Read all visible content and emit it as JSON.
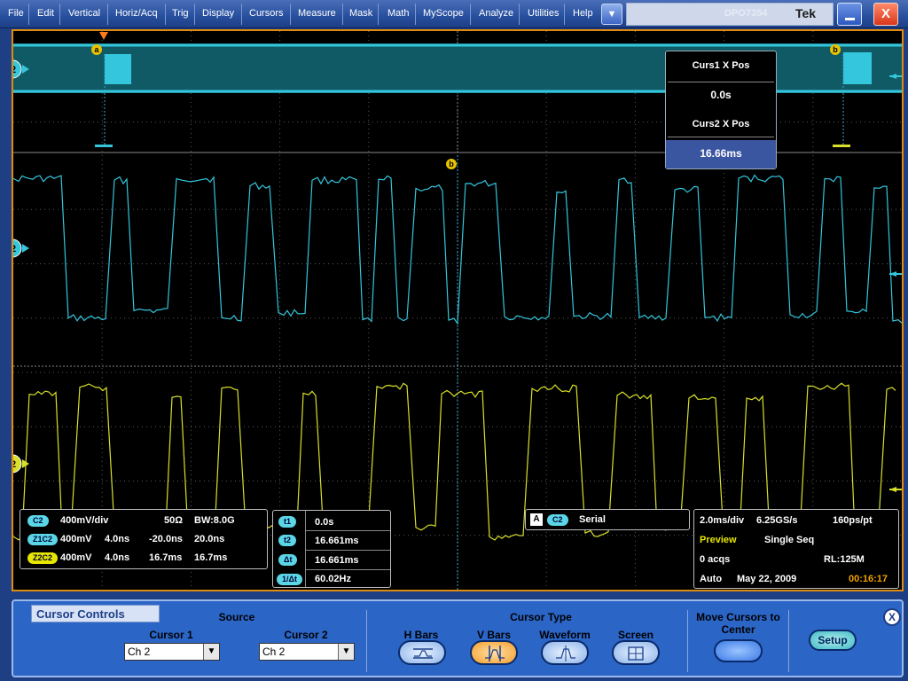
{
  "menubar": {
    "items": [
      "File",
      "Edit",
      "Vertical",
      "Horiz/Acq",
      "Trig",
      "Display",
      "Cursors",
      "Measure",
      "Mask",
      "Math",
      "MyScope",
      "Analyze",
      "Utilities",
      "Help"
    ],
    "dropdown_label": "▼",
    "logo_text": "DPO7354",
    "brand": "Tek",
    "close_label": "X"
  },
  "scope": {
    "channel_marker": "2",
    "cursor_a_label": "a",
    "cursor_b_label": "b",
    "colors": {
      "ch2": "#34c6dc",
      "zoom2": "#d8e02a",
      "trigger": "#ff7a1a",
      "grid": "#5a5a5a",
      "cursor": "#3aa8d6"
    }
  },
  "cursor_readout": {
    "c1_label": "Curs1 X Pos",
    "c1_value": "0.0s",
    "c2_label": "Curs2 X Pos",
    "c2_value": "16.66ms"
  },
  "channel_readout": {
    "rows": [
      {
        "badge": "C2",
        "a": "400mV/div",
        "b": "50Ω",
        "c": "BW:8.0G",
        "d": ""
      },
      {
        "badge": "Z1C2",
        "a": "400mV",
        "b": "4.0ns",
        "c": "-20.0ns",
        "d": "20.0ns"
      },
      {
        "badge": "Z2C2",
        "a": "400mV",
        "b": "4.0ns",
        "c": "16.7ms",
        "d": "16.7ms"
      }
    ]
  },
  "delta_readout": {
    "rows": [
      {
        "badge": "t1",
        "value": "0.0s"
      },
      {
        "badge": "t2",
        "value": "16.661ms"
      },
      {
        "badge": "Δt",
        "value": "16.661ms"
      },
      {
        "badge": "1/Δt",
        "value": "60.02Hz"
      }
    ]
  },
  "trigger_readout": {
    "badge_a": "A",
    "badge_c": "C2",
    "type": "Serial"
  },
  "acq_readout": {
    "hscale": "2.0ms/div",
    "rate": "6.25GS/s",
    "resolution": "160ps/pt",
    "mode": "Preview",
    "run": "Single Seq",
    "acqs": "0 acqs",
    "record": "RL:125M",
    "trig_mode": "Auto",
    "date": "May 22, 2009",
    "time": "00:16:17"
  },
  "panel": {
    "title": "Cursor Controls",
    "source_label": "Source",
    "cursor1_label": "Cursor 1",
    "cursor1_value": "Ch 2",
    "cursor2_label": "Cursor 2",
    "cursor2_value": "Ch 2",
    "cursor_type_label": "Cursor Type",
    "types": [
      "H Bars",
      "V Bars",
      "Waveform",
      "Screen"
    ],
    "active_type": "V Bars",
    "move_label": "Move Cursors to Center",
    "setup_label": "Setup",
    "close_label": "X"
  }
}
